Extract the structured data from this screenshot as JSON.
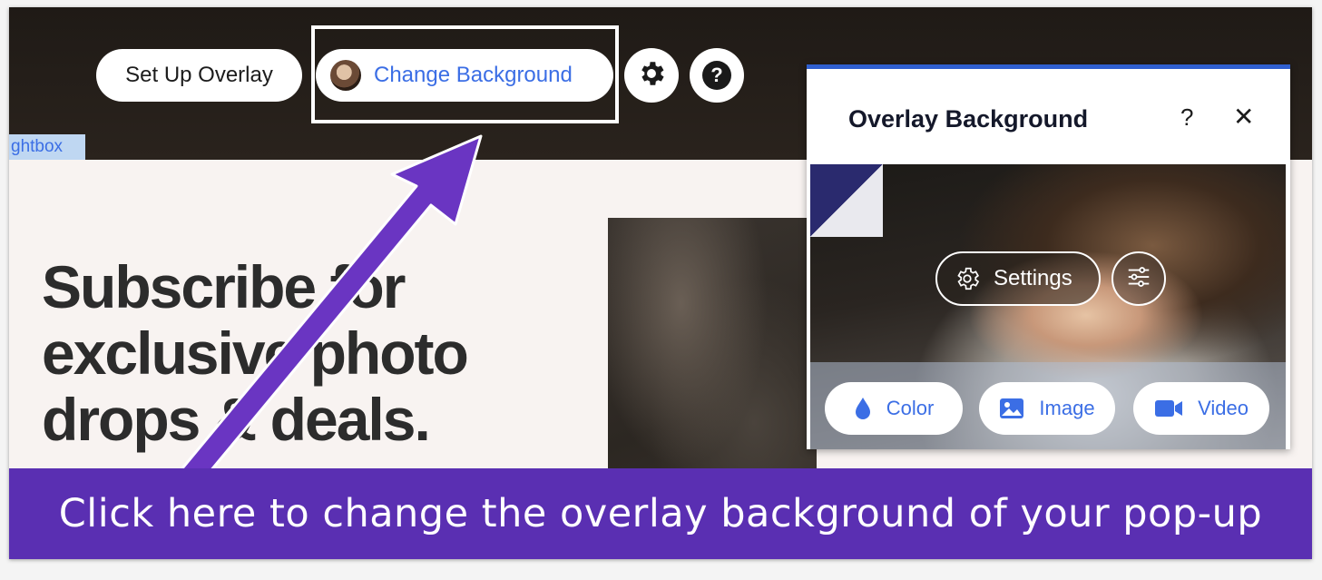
{
  "toolbar": {
    "setup_label": "Set Up Overlay",
    "change_label": "Change Background",
    "gear_icon": "gear-icon",
    "help_icon": "help-icon",
    "help_glyph": "?"
  },
  "lightbox_tag": "ghtbox",
  "headline": {
    "line1": "Subscribe for",
    "line2": "exclusive photo",
    "line3": "drops & deals."
  },
  "panel": {
    "title": "Overlay Background",
    "help_glyph": "?",
    "close_glyph": "✕",
    "settings_label": "Settings",
    "buttons": {
      "color": "Color",
      "image": "Image",
      "video": "Video"
    }
  },
  "callout_text": "Click here to change the overlay background of your pop-up",
  "colors": {
    "accent_blue": "#3b6ee5",
    "callout_purple": "#5a2fb2",
    "arrow_purple": "#6a35c2"
  }
}
